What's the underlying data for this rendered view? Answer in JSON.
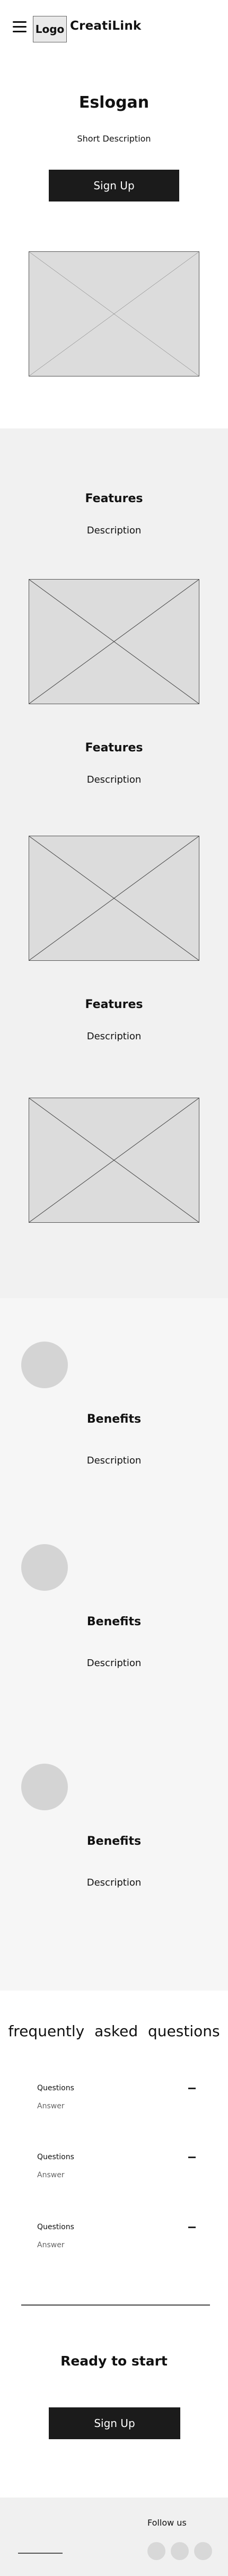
{
  "header": {
    "logo": "Logo",
    "brand": "CreatiLink"
  },
  "hero": {
    "title": "Eslogan",
    "description": "Short Description",
    "button": "Sign Up"
  },
  "features": [
    {
      "title": "Features",
      "description": "Description"
    },
    {
      "title": "Features",
      "description": "Description"
    },
    {
      "title": "Features",
      "description": "Description"
    }
  ],
  "benefits": [
    {
      "title": "Benefits",
      "description": "Description"
    },
    {
      "title": "Benefits",
      "description": "Description"
    },
    {
      "title": "Benefits",
      "description": "Description"
    }
  ],
  "faq": {
    "title": "frequently asked questions",
    "items": [
      {
        "question": "Questions",
        "answer": "Answer"
      },
      {
        "question": "Questions",
        "answer": "Answer"
      },
      {
        "question": "Questions",
        "answer": "Answer"
      }
    ]
  },
  "cta": {
    "title": "Ready to start",
    "button": "Sign Up"
  },
  "footer": {
    "follow": "Follow us"
  }
}
